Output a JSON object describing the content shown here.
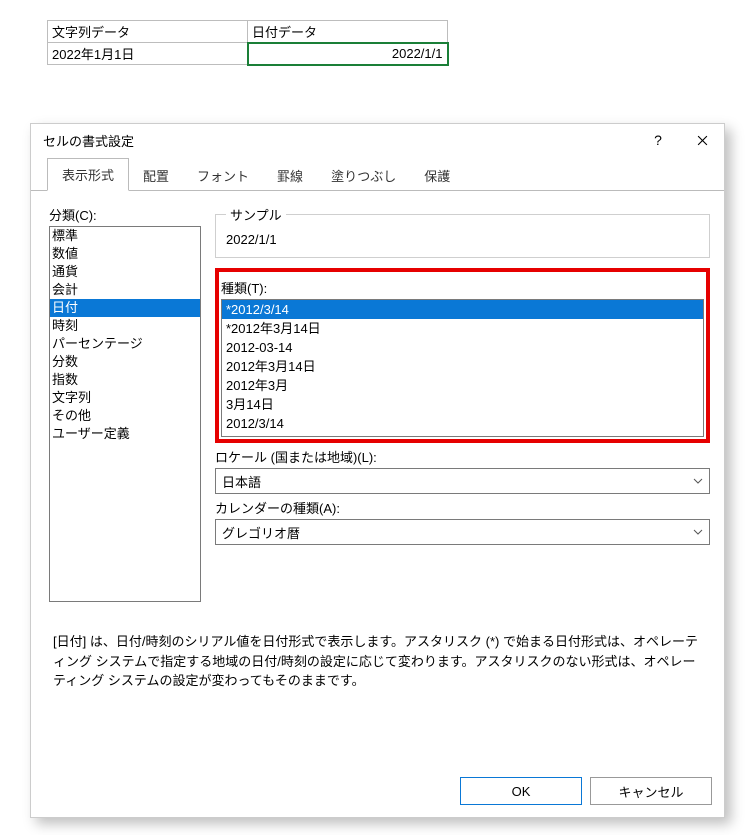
{
  "sheet": {
    "headers": [
      "文字列データ",
      "日付データ"
    ],
    "row": [
      "2022年1月1日",
      "2022/1/1"
    ]
  },
  "dialog": {
    "title": "セルの書式設定",
    "tabs": [
      "表示形式",
      "配置",
      "フォント",
      "罫線",
      "塗りつぶし",
      "保護"
    ],
    "category_label": "分類(C):",
    "categories": [
      "標準",
      "数値",
      "通貨",
      "会計",
      "日付",
      "時刻",
      "パーセンテージ",
      "分数",
      "指数",
      "文字列",
      "その他",
      "ユーザー定義"
    ],
    "category_selected_index": 4,
    "sample_label": "サンプル",
    "sample_value": "2022/1/1",
    "type_label": "種類(T):",
    "types": [
      "*2012/3/14",
      "*2012年3月14日",
      "2012-03-14",
      "2012年3月14日",
      "2012年3月",
      "3月14日",
      "2012/3/14"
    ],
    "type_selected_index": 0,
    "locale_label": "ロケール (国または地域)(L):",
    "locale_value": "日本語",
    "calendar_label": "カレンダーの種類(A):",
    "calendar_value": "グレゴリオ暦",
    "description": "[日付] は、日付/時刻のシリアル値を日付形式で表示します。アスタリスク (*) で始まる日付形式は、オペレーティング システムで指定する地域の日付/時刻の設定に応じて変わります。アスタリスクのない形式は、オペレーティング システムの設定が変わってもそのままです。",
    "ok": "OK",
    "cancel": "キャンセル"
  }
}
